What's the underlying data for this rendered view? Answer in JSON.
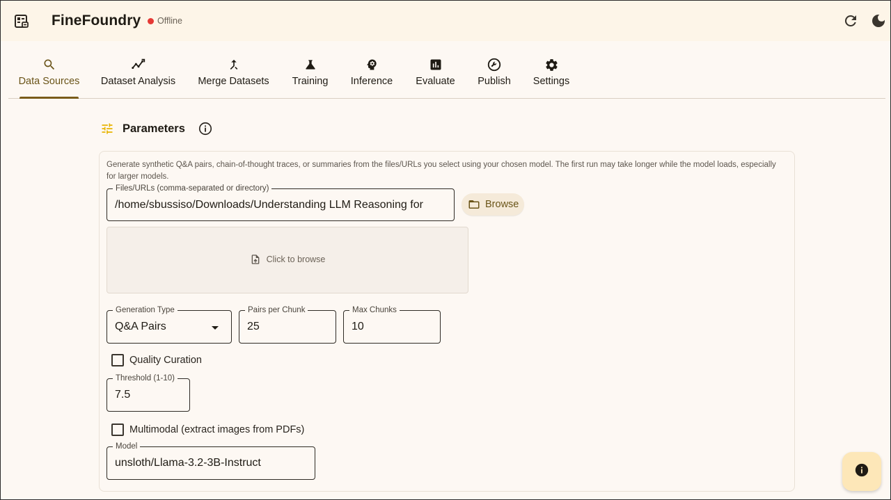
{
  "app": {
    "title": "FineFoundry",
    "status": "Offline",
    "status_color": "#e53935"
  },
  "tabs": [
    {
      "label": "Data Sources",
      "icon": "search-icon",
      "active": true
    },
    {
      "label": "Dataset Analysis",
      "icon": "trend-icon",
      "active": false
    },
    {
      "label": "Merge Datasets",
      "icon": "merge-icon",
      "active": false
    },
    {
      "label": "Training",
      "icon": "flask-icon",
      "active": false
    },
    {
      "label": "Inference",
      "icon": "brain-icon",
      "active": false
    },
    {
      "label": "Evaluate",
      "icon": "bar-chart-icon",
      "active": false
    },
    {
      "label": "Publish",
      "icon": "build-icon",
      "active": false
    },
    {
      "label": "Settings",
      "icon": "gear-icon",
      "active": false
    }
  ],
  "section": {
    "title": "Parameters"
  },
  "form": {
    "description": "Generate synthetic Q&A pairs, chain-of-thought traces, or summaries from the files/URLs you select using your chosen model. The first run may take longer while the model loads, especially for larger models.",
    "files": {
      "label": "Files/URLs (comma-separated or directory)",
      "value": "/home/sbussiso/Downloads/Understanding LLM Reasoning for"
    },
    "browse_label": "Browse",
    "dropzone_label": "Click to browse",
    "generation_type": {
      "label": "Generation Type",
      "value": "Q&A Pairs"
    },
    "pairs_per_chunk": {
      "label": "Pairs per Chunk",
      "value": "25"
    },
    "max_chunks": {
      "label": "Max Chunks",
      "value": "10"
    },
    "quality_curation": {
      "label": "Quality Curation",
      "checked": false
    },
    "threshold": {
      "label": "Threshold (1-10)",
      "value": "7.5"
    },
    "multimodal": {
      "label": "Multimodal (extract images from PDFs)",
      "checked": false
    },
    "model": {
      "label": "Model",
      "value": "unsloth/Llama-3.2-3B-Instruct"
    }
  },
  "colors": {
    "accent": "#7a5c1b",
    "background": "#fdf8f3",
    "fab": "#fde7b8"
  }
}
